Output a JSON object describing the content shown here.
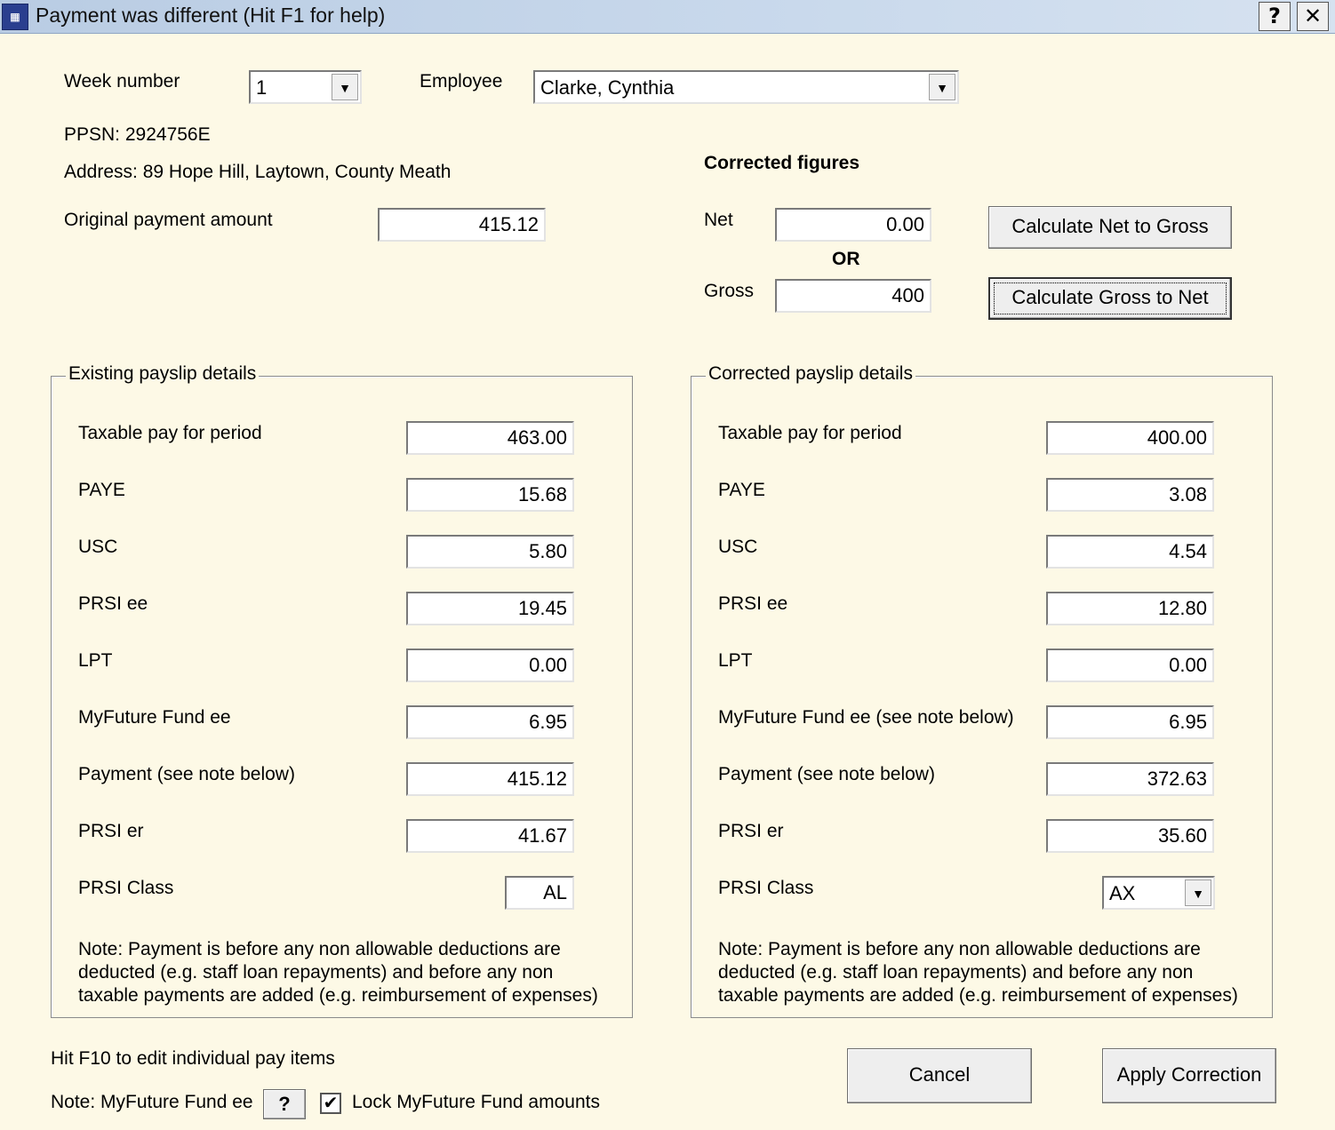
{
  "window": {
    "title": "Payment was different (Hit F1 for help)",
    "help_button": "?",
    "close_button": "✕"
  },
  "header": {
    "week_label": "Week number",
    "week_value": "1",
    "employee_label": "Employee",
    "employee_value": "Clarke, Cynthia",
    "ppsn": "PPSN: 2924756E",
    "address": "Address: 89 Hope Hill, Laytown, County Meath",
    "original_payment_label": "Original payment amount",
    "original_payment_value": "415.12"
  },
  "corrected_figures": {
    "heading": "Corrected figures",
    "net_label": "Net",
    "net_value": "0.00",
    "or_label": "OR",
    "gross_label": "Gross",
    "gross_value": "400",
    "net_to_gross_button": "Calculate Net to Gross",
    "gross_to_net_button": "Calculate Gross to Net"
  },
  "existing": {
    "legend": "Existing payslip details",
    "rows": [
      {
        "label": "Taxable pay for period",
        "value": "463.00"
      },
      {
        "label": "PAYE",
        "value": "15.68"
      },
      {
        "label": "USC",
        "value": "5.80"
      },
      {
        "label": "PRSI ee",
        "value": "19.45"
      },
      {
        "label": "LPT",
        "value": "0.00"
      },
      {
        "label": "MyFuture Fund ee",
        "value": "6.95"
      },
      {
        "label": "Payment (see note below)",
        "value": "415.12"
      },
      {
        "label": "PRSI er",
        "value": "41.67"
      }
    ],
    "prsi_class_label": "PRSI Class",
    "prsi_class_value": "AL",
    "note": "Note: Payment is before any non allowable deductions are deducted (e.g. staff loan repayments) and before any non taxable payments are added (e.g. reimbursement of expenses)"
  },
  "corrected": {
    "legend": "Corrected payslip details",
    "rows": [
      {
        "label": "Taxable pay for period",
        "value": "400.00"
      },
      {
        "label": "PAYE",
        "value": "3.08"
      },
      {
        "label": "USC",
        "value": "4.54"
      },
      {
        "label": "PRSI ee",
        "value": "12.80"
      },
      {
        "label": "LPT",
        "value": "0.00"
      },
      {
        "label": "MyFuture Fund ee (see note below)",
        "value": "6.95"
      },
      {
        "label": "Payment (see note below)",
        "value": "372.63"
      },
      {
        "label": "PRSI er",
        "value": "35.60"
      }
    ],
    "prsi_class_label": "PRSI Class",
    "prsi_class_value": "AX",
    "note": "Note: Payment is before any non allowable deductions are deducted (e.g. staff loan repayments) and before any non taxable payments are added (e.g. reimbursement of expenses)"
  },
  "footer": {
    "f10_hint": "Hit F10 to edit individual pay items",
    "myfuture_note_label": "Note: MyFuture Fund ee",
    "myfuture_help_button": "?",
    "lock_checkbox_label": "Lock MyFuture Fund amounts",
    "lock_checked": true,
    "cancel_button": "Cancel",
    "apply_button": "Apply Correction"
  }
}
